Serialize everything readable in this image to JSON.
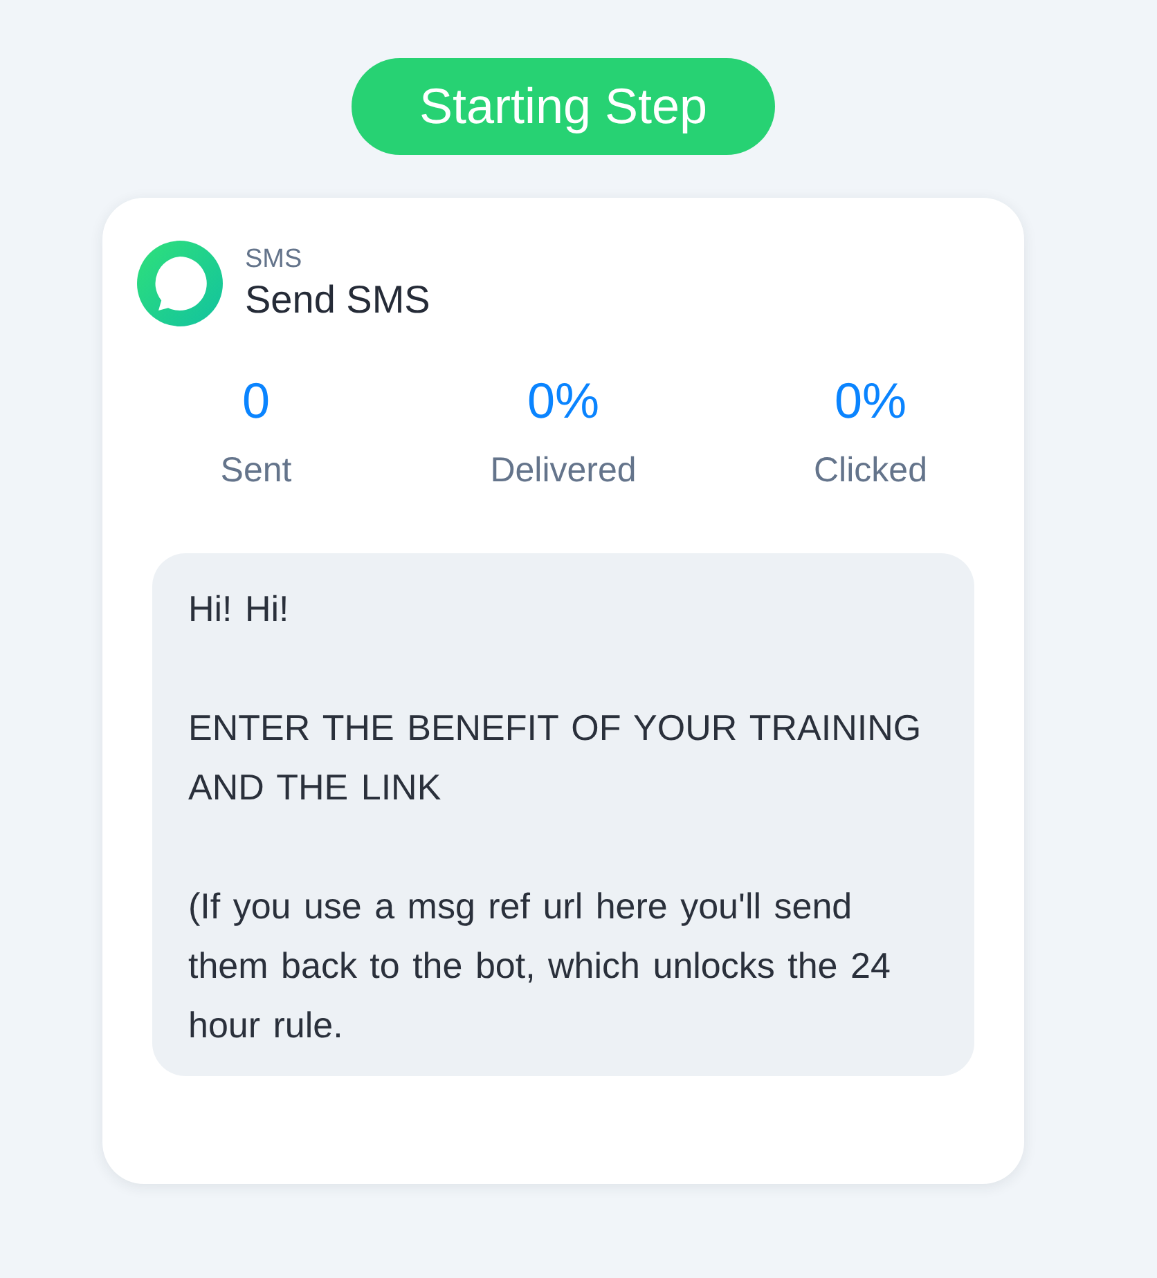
{
  "step_badge": {
    "label": "Starting Step"
  },
  "step": {
    "channel": "SMS",
    "title": "Send SMS"
  },
  "stats": [
    {
      "value": "0",
      "label": "Sent"
    },
    {
      "value": "0%",
      "label": "Delivered"
    },
    {
      "value": "0%",
      "label": "Clicked"
    }
  ],
  "message": {
    "paragraphs": [
      "Hi! Hi!",
      "ENTER THE BENEFIT OF YOUR TRAINING AND THE LINK",
      "(If you use a msg ref url here you'll send them back to the bot, which unlocks the 24 hour rule."
    ]
  }
}
